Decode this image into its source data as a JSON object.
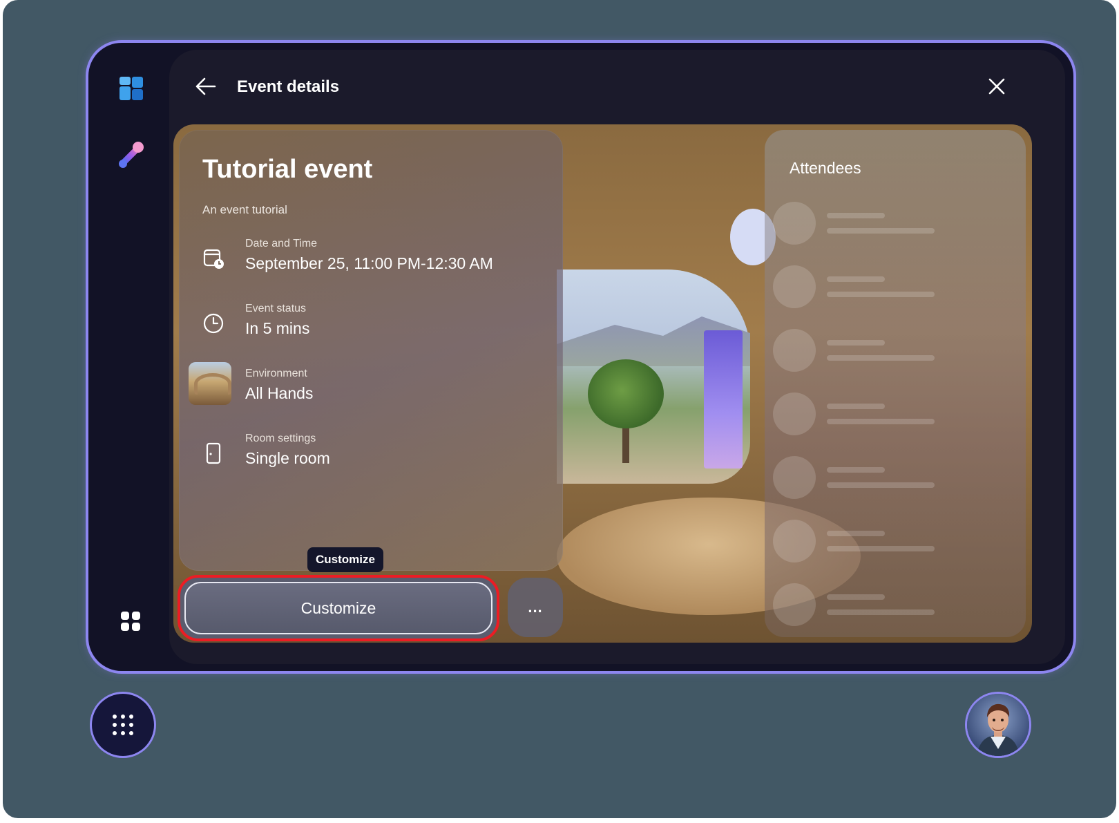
{
  "header": {
    "title": "Event details"
  },
  "event": {
    "name": "Tutorial event",
    "description": "An event tutorial",
    "details": [
      {
        "label": "Date and Time",
        "value": "September 25, 11:00 PM-12:30 AM",
        "icon": "calendar-clock-icon"
      },
      {
        "label": "Event status",
        "value": "In 5 mins",
        "icon": "clock-icon"
      },
      {
        "label": "Environment",
        "value": "All Hands",
        "icon": "environment-thumbnail"
      },
      {
        "label": "Room settings",
        "value": "Single room",
        "icon": "door-icon"
      }
    ]
  },
  "actions": {
    "tooltip": "Customize",
    "customize_label": "Customize",
    "more_label": "..."
  },
  "attendees": {
    "title": "Attendees",
    "placeholder_rows": 7
  },
  "icons": {
    "rail": [
      "windows-icon",
      "mesh-icon",
      "apps-grid-icon"
    ],
    "header": [
      "back-arrow-icon",
      "close-icon"
    ],
    "bottom": [
      "launcher-dots-icon",
      "profile-avatar"
    ]
  },
  "colors": {
    "background": "#425865",
    "frame_glow": "#8d86f0",
    "panel": "#1b1a2b",
    "highlight": "#ec1c24"
  }
}
